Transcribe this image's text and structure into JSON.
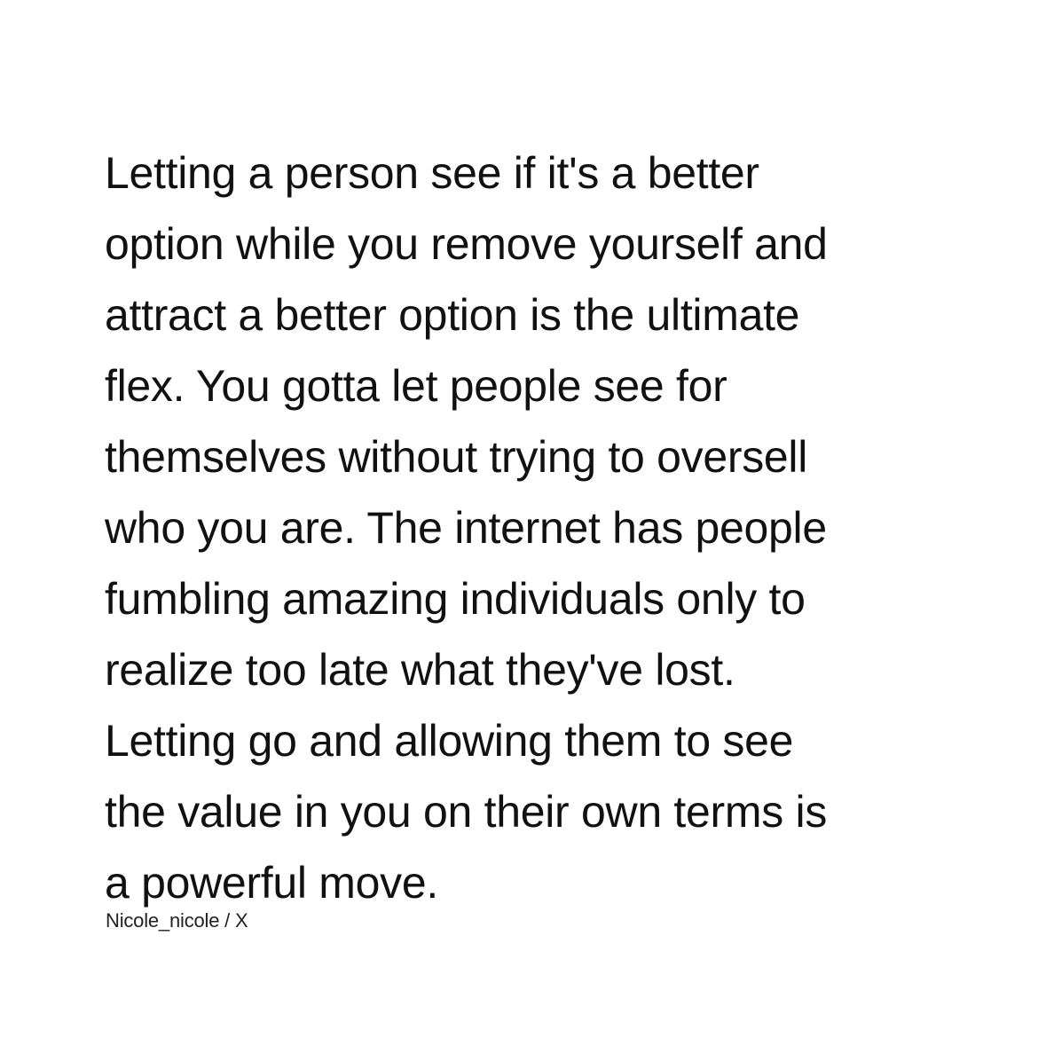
{
  "quote": {
    "lines": [
      "Letting a person see if it's a better",
      "option while you remove yourself and",
      "attract a better option is the ultimate",
      "flex. You gotta let people see for",
      "themselves without trying to oversell",
      "who you are. The internet has people",
      "fumbling amazing individuals only to",
      "realize too late what they've lost.",
      "Letting go and allowing them to see",
      "the value in you on their own terms is",
      "a powerful move."
    ]
  },
  "attribution": "Nicole_nicole / X",
  "colors": {
    "background": "#ffffff",
    "text": "#111111"
  }
}
